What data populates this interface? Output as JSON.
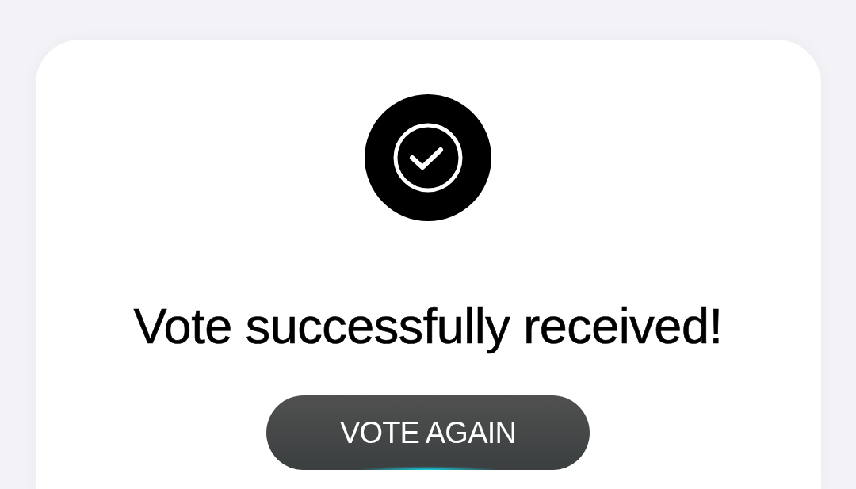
{
  "heading": "Vote successfully received!",
  "button": {
    "label": "VOTE AGAIN"
  }
}
